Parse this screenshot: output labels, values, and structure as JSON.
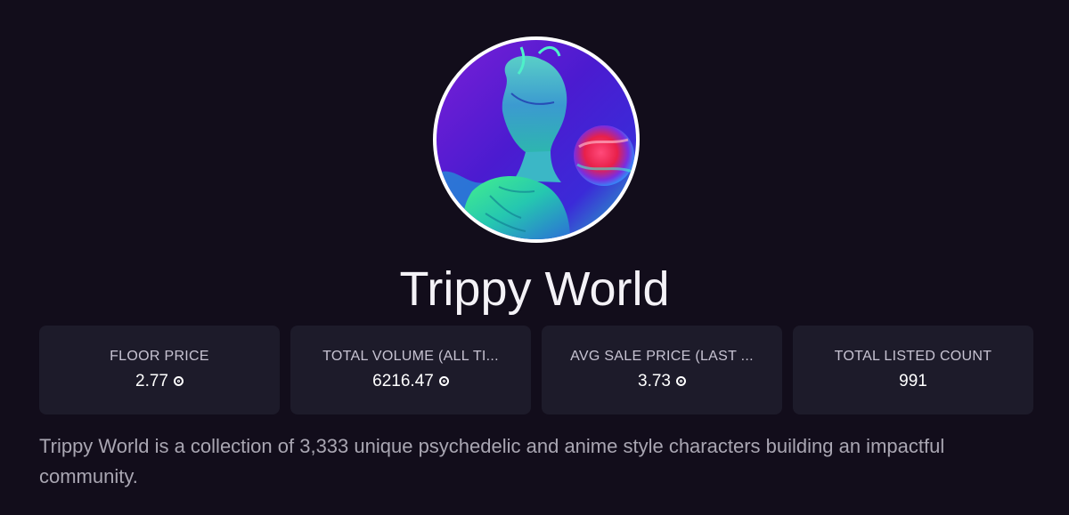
{
  "collection": {
    "name": "Trippy World",
    "avatar_icon": "collection-avatar-psychedelic-anime-character",
    "description": "Trippy World is a collection of 3,333 unique psychedelic and anime style characters building an impactful community."
  },
  "stats": [
    {
      "label": "FLOOR PRICE",
      "value": "2.77",
      "currency_icon": "sol-icon"
    },
    {
      "label": "TOTAL VOLUME (ALL TI...",
      "value": "6216.47",
      "currency_icon": "sol-icon"
    },
    {
      "label": "AVG SALE PRICE (LAST ...",
      "value": "3.73",
      "currency_icon": "sol-icon"
    },
    {
      "label": "TOTAL LISTED COUNT",
      "value": "991"
    }
  ],
  "colors": {
    "background": "#120d1b",
    "card": "#1d1b2a",
    "label": "#c7c3d2",
    "description": "#a9a6b2"
  }
}
